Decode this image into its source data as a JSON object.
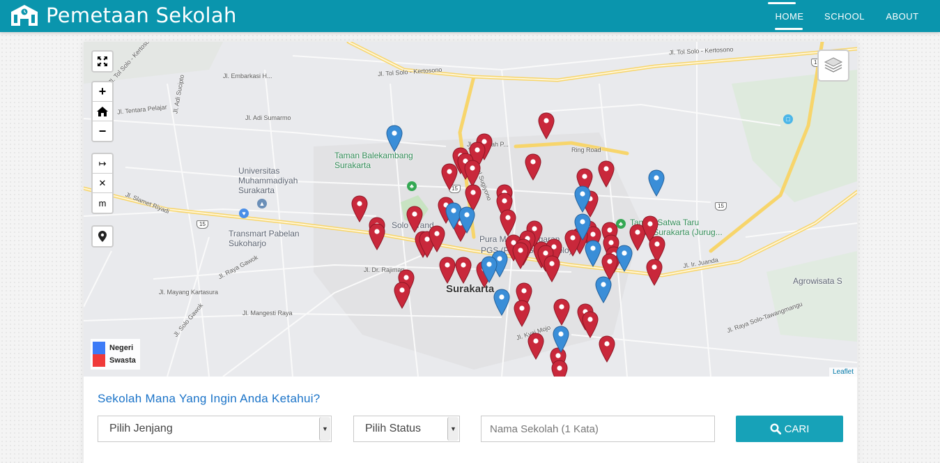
{
  "navbar": {
    "brand": "Pemetaan Sekolah",
    "brand_icon": "school-building-icon",
    "links": [
      {
        "label": "HOME",
        "active": true
      },
      {
        "label": "SCHOOL",
        "active": false
      },
      {
        "label": "ABOUT",
        "active": false
      }
    ],
    "color": "#0a95ad"
  },
  "map": {
    "controls": {
      "fullscreen_icon": "fullscreen-icon",
      "zoom_in": "+",
      "zoom_out": "−",
      "home_icon": "home-icon",
      "measure_arrow": "↦",
      "measure_clear": "✕",
      "measure_unit": "m",
      "locate_icon": "location-pin-icon",
      "layers_icon": "layers-icon"
    },
    "labels": {
      "tol_left": "Jl. Tol Solo - Kertosono",
      "tol_mid": "Jl. Tol Solo - Kertosono",
      "tol_right": "Jl. Tol Solo - Kertosono",
      "embarkasi": "Jl. Embarkasi H...",
      "tentara": "Jl. Tentara Pelajar",
      "adi_sucipto": "Jl. Adi Sucipto",
      "adi_sumarmo": "Jl. Adi Sumarmo",
      "slamet": "Jl. Slamet Riyadi",
      "raya_gawok": "Jl. Raya Gawok",
      "mayang": "Jl. Mayang Kartasura",
      "mangesti": "Jl. Mangesti Raya",
      "solo_gawok": "Jl. Solo Gawok",
      "dr_rajiman": "Jl. Dr. Rajiman",
      "kolonel": "Jl. Kolonel Sugiyono",
      "sumpah": "Jl. Sumpah P...",
      "juanda": "Jl. Ir. Juanda",
      "raya_solo": "Jl. Raya Solo-Tawangmangu",
      "kyai_mojo": "Jl. Kyai Mojo",
      "ring_road": "Ring Road",
      "ums": "Universitas\nMuhammadiyah\nSurakarta",
      "taman": "Taman Balekambang\nSurakarta",
      "transmart": "Transmart Pabelan\nSukoharjo",
      "solo_grand": "Solo Grand",
      "pura": "Pura Mangkunegaran",
      "pgs": "PGS (Pusat Grosir Solo)",
      "surakarta": "Surakarta",
      "jurug": "Taman Satwa Taru\nJurug Surakarta (Jurug...",
      "agro": "Agrowisata S"
    },
    "route_number": "15",
    "markers": {
      "negeri": [
        [
          446,
          155
        ],
        [
          597,
          335
        ],
        [
          716,
          242
        ],
        [
          716,
          282
        ],
        [
          822,
          219
        ],
        [
          531,
          266
        ],
        [
          550,
          272
        ],
        [
          731,
          320
        ],
        [
          776,
          327
        ],
        [
          746,
          372
        ],
        [
          600,
          390
        ],
        [
          685,
          443
        ],
        [
          582,
          343
        ]
      ],
      "swasta": [
        [
          664,
          137
        ],
        [
          575,
          167
        ],
        [
          565,
          179
        ],
        [
          541,
          187
        ],
        [
          548,
          195
        ],
        [
          525,
          210
        ],
        [
          558,
          205
        ],
        [
          645,
          196
        ],
        [
          750,
          206
        ],
        [
          719,
          217
        ],
        [
          396,
          256
        ],
        [
          559,
          240
        ],
        [
          604,
          240
        ],
        [
          604,
          252
        ],
        [
          727,
          249
        ],
        [
          475,
          271
        ],
        [
          520,
          258
        ],
        [
          609,
          276
        ],
        [
          421,
          287
        ],
        [
          421,
          296
        ],
        [
          487,
          307
        ],
        [
          493,
          307
        ],
        [
          507,
          299
        ],
        [
          541,
          284
        ],
        [
          647,
          292
        ],
        [
          725,
          292
        ],
        [
          755,
          294
        ],
        [
          731,
          300
        ],
        [
          712,
          302
        ],
        [
          702,
          305
        ],
        [
          795,
          297
        ],
        [
          813,
          285
        ],
        [
          617,
          312
        ],
        [
          637,
          306
        ],
        [
          631,
          318
        ],
        [
          627,
          323
        ],
        [
          657,
          322
        ],
        [
          675,
          318
        ],
        [
          663,
          327
        ],
        [
          672,
          342
        ],
        [
          757,
          312
        ],
        [
          823,
          314
        ],
        [
          761,
          329
        ],
        [
          755,
          339
        ],
        [
          522,
          344
        ],
        [
          545,
          344
        ],
        [
          575,
          350
        ],
        [
          819,
          347
        ],
        [
          463,
          362
        ],
        [
          457,
          380
        ],
        [
          632,
          381
        ],
        [
          686,
          404
        ],
        [
          629,
          406
        ],
        [
          720,
          411
        ],
        [
          727,
          422
        ],
        [
          649,
          453
        ],
        [
          751,
          457
        ],
        [
          681,
          474
        ],
        [
          683,
          492
        ]
      ]
    }
  },
  "legend": {
    "items": [
      {
        "label": "Negeri",
        "color": "#3d7bf7"
      },
      {
        "label": "Swasta",
        "color": "#f03a3a"
      }
    ]
  },
  "attribution": "Leaflet",
  "search": {
    "title": "Sekolah Mana Yang Ingin Anda Ketahui?",
    "jenjang_label": "Pilih Jenjang",
    "status_label": "Pilih Status",
    "nama_placeholder": "Nama Sekolah (1 Kata)",
    "button_label": "CARI",
    "button_color": "#17a2b8"
  }
}
